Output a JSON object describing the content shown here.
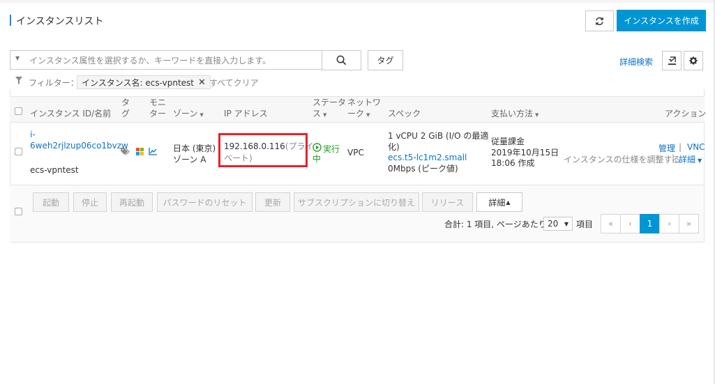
{
  "header": {
    "title": "インスタンスリスト",
    "create_button": "インスタンスを作成"
  },
  "search": {
    "placeholder": "インスタンス属性を選択するか、キーワードを直接入力します。",
    "tag_button": "タグ",
    "advanced_search": "詳細検索"
  },
  "filter": {
    "label": "フィルター：",
    "chip": "インスタンス名: ecs-vpntest",
    "clear_all": "すべてクリア"
  },
  "table": {
    "headers": {
      "instance_id": "インスタンス ID/名前",
      "tag": [
        "タ",
        "グ"
      ],
      "monitor": [
        "モニ",
        "ター"
      ],
      "zone": "ゾーン",
      "ip": "IP アドレス",
      "status": [
        "ステータ",
        "ス"
      ],
      "network": [
        "ネットワ",
        "ーク"
      ],
      "spec": "スペック",
      "billing": "支払い方法",
      "action": "アクション"
    },
    "row": {
      "id_line1": "i-",
      "id_line2": "6weh2rjlzup06co1bvzw",
      "name": "ecs-vpntest",
      "zone_line1": "日本 (東京)",
      "zone_line2": "ゾーン A",
      "ip_addr": "192.168.0.116",
      "ip_type_1": "(プライ",
      "ip_type_2": "ベート)",
      "status_1": "実行",
      "status_2": "中",
      "network": "VPC",
      "spec_line1": "1 vCPU 2 GiB (I/O の最適",
      "spec_line2": "化)",
      "spec_type": "ecs.t5-lc1m2.small",
      "spec_bandwidth": "0Mbps (ピーク値)",
      "billing_line1": "従量課金",
      "billing_line2": "2019年10月15日",
      "billing_line3": "18:06 作成",
      "action_manage": "管理",
      "action_sep": "|",
      "action_vnc": "VNC",
      "action_resize": "インスタンスの仕様を調整する",
      "action_more": "詳細"
    }
  },
  "batch": {
    "start": "起動",
    "stop": "停止",
    "restart": "再起動",
    "reset_password": "パスワードのリセット",
    "renew": "更新",
    "switch_subscription": "サブスクリプションに切り替え",
    "release": "リリース",
    "more": "詳細"
  },
  "pagination": {
    "summary": "合計: 1 項目, ページあたり:",
    "page_size": "20",
    "unit": "項目",
    "first": "«",
    "prev": "‹",
    "current": "1",
    "next": "›",
    "last": "»"
  },
  "colors": {
    "primary": "#0096d6",
    "link": "#0d73c9",
    "running": "#1aa01a",
    "highlight": "#e8202a"
  }
}
